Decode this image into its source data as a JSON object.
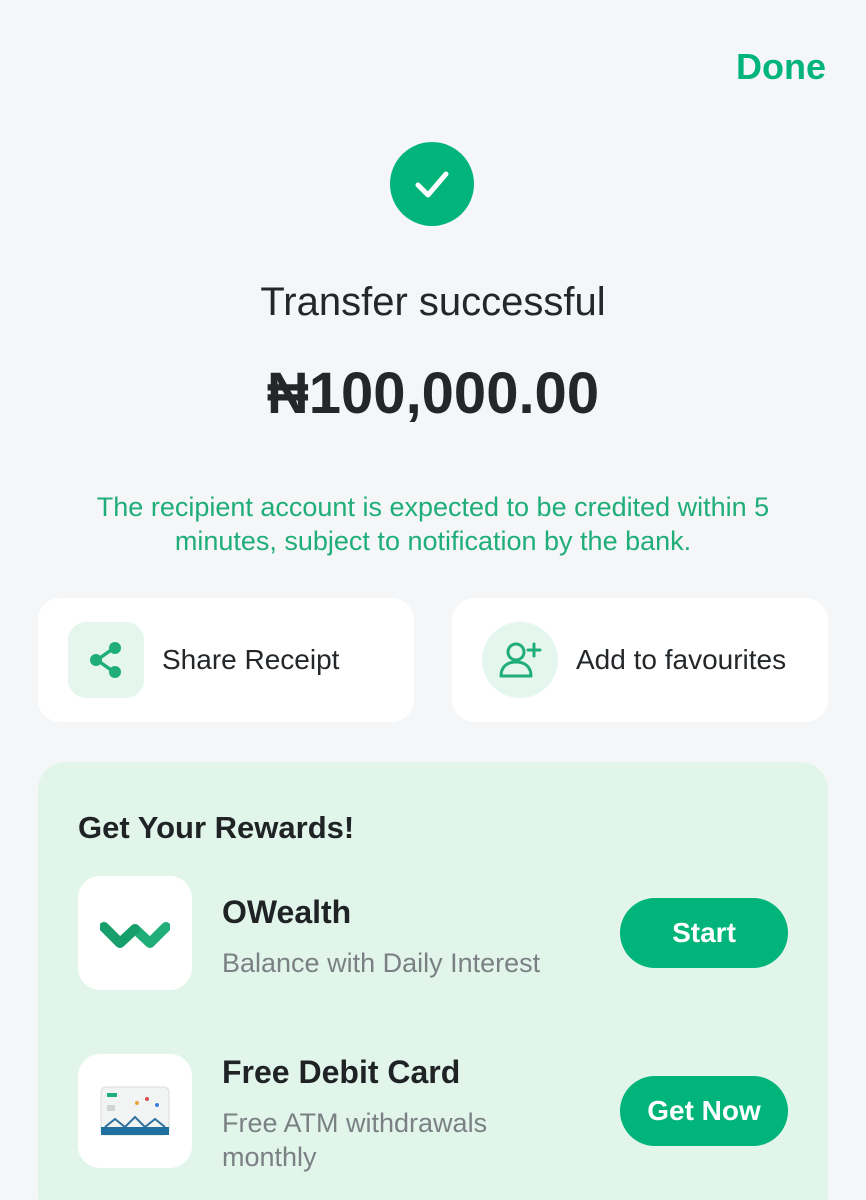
{
  "header": {
    "done_label": "Done"
  },
  "status": {
    "title": "Transfer successful",
    "amount": "₦100,000.00",
    "note": "The recipient account is expected to be credited within 5 minutes, subject to notification by the bank."
  },
  "actions": [
    {
      "label": "Share Receipt",
      "icon": "share-icon"
    },
    {
      "label": "Add to favourites",
      "icon": "add-user-icon"
    }
  ],
  "rewards": {
    "title": "Get Your Rewards!",
    "items": [
      {
        "name": "OWealth",
        "desc": "Balance with Daily Interest",
        "button": "Start",
        "icon": "owealth-logo-icon"
      },
      {
        "name": "Free Debit Card",
        "desc": "Free ATM withdrawals monthly",
        "button": "Get Now",
        "icon": "debit-card-icon"
      }
    ]
  },
  "colors": {
    "accent": "#00b47a",
    "accent_light": "#e1f5ea",
    "background": "#f5f6f8"
  }
}
